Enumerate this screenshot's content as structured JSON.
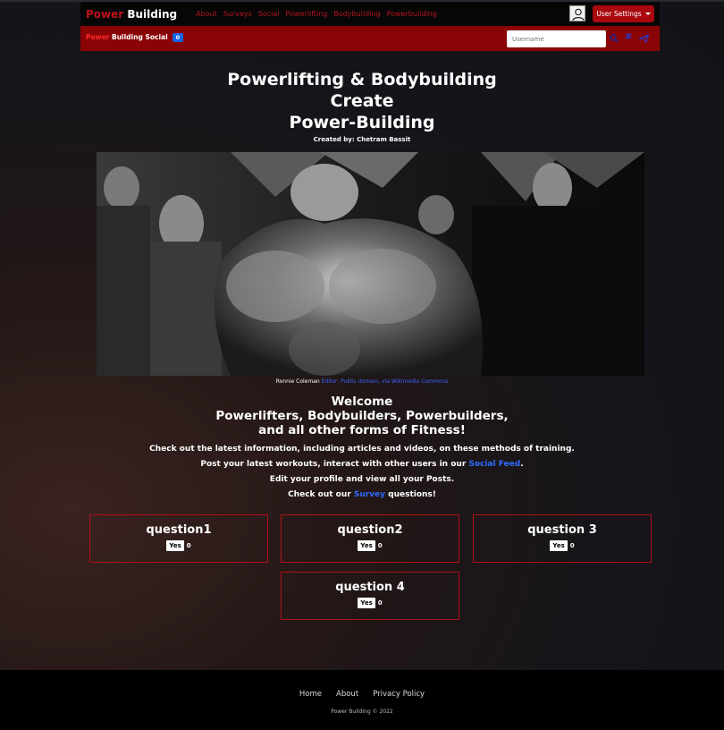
{
  "navbar": {
    "brand_red": "Power",
    "brand_white": " Building",
    "links": [
      "About",
      "Surveys",
      "Social",
      "Powerlifting",
      "Bodybuilding",
      "Powerbuilding"
    ],
    "user_settings_label": "User Settings"
  },
  "subbar": {
    "brand_red": "Power",
    "brand_white": " Building Social",
    "badge_count": "0",
    "search_placeholder": "Username",
    "hashtag": "#"
  },
  "hero": {
    "title_line1": "Powerlifting & Bodybuilding",
    "title_line2": "Create",
    "title_line3": "Power-Building",
    "created_by": "Created by: Chetram Bassit"
  },
  "photo_caption": {
    "name": "Ronnie Coleman",
    "link": "Editor, Public domain, via Wikimedia Commons"
  },
  "welcome": {
    "line1": "Welcome",
    "line2": "Powerlifters, Bodybuilders, Powerbuilders,",
    "line3": "and all other forms of Fitness!"
  },
  "info": {
    "line1": "Check out the latest information, including articles and videos, on these methods of training.",
    "line2_pre": "Post your latest workouts, interact with other users in our ",
    "line2_link": "Social Feed",
    "line2_post": ".",
    "line3": "Edit your profile and view all your Posts.",
    "line4_pre": "Check out our ",
    "line4_link": "Survey",
    "line4_post": " questions!"
  },
  "questions": [
    {
      "title": "question1",
      "yes_label": "Yes",
      "count": "0"
    },
    {
      "title": "question2",
      "yes_label": "Yes",
      "count": "0"
    },
    {
      "title": "question 3",
      "yes_label": "Yes",
      "count": "0"
    },
    {
      "title": "question 4",
      "yes_label": "Yes",
      "count": "0"
    }
  ],
  "footer": {
    "links": [
      "Home",
      "About",
      "Privacy Policy"
    ],
    "copyright": "Power Building © 2022"
  },
  "colors": {
    "brand_red": "#c0121a",
    "subbar_red": "#8a0406",
    "link_blue": "#2f6bff",
    "badge_blue": "#1565e8"
  }
}
